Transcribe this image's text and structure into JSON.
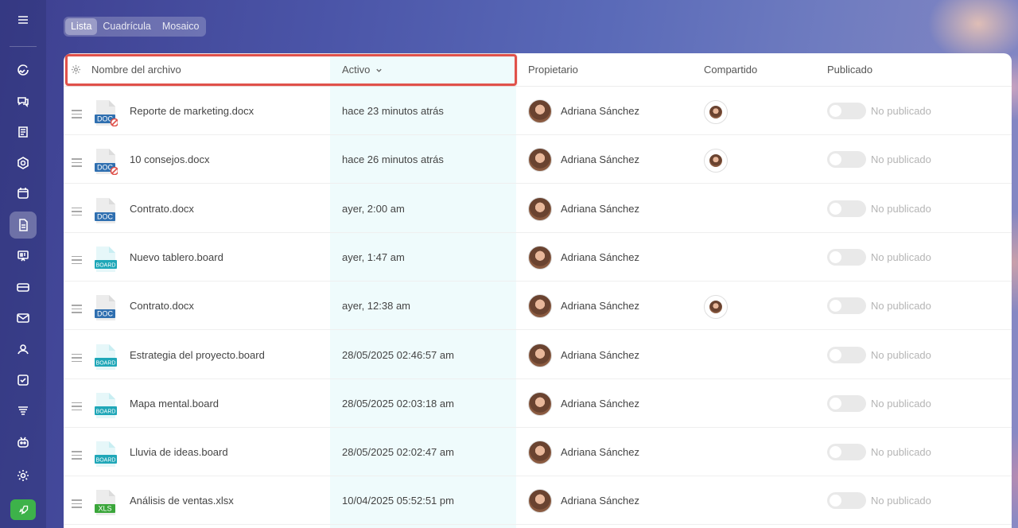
{
  "view_switch": {
    "options": [
      "Lista",
      "Cuadrícula",
      "Mosaico"
    ],
    "active": "Lista"
  },
  "sidebar": {
    "icons": [
      "menu-icon",
      "feed-icon",
      "chat-icon",
      "tasks-doc-icon",
      "disk-icon",
      "calendar-icon",
      "documents-icon",
      "boards-icon",
      "drive-icon",
      "mail-icon",
      "contacts-icon",
      "checklist-icon",
      "filter-icon",
      "robot-icon",
      "settings-icon",
      "rocket-icon"
    ],
    "active": "documents-icon",
    "accent": "#3db24a"
  },
  "table": {
    "headers": {
      "name": "Nombre del archivo",
      "active": "Activo",
      "owner": "Propietario",
      "shared": "Compartido",
      "published": "Publicado"
    },
    "highlight_color": "#e0514a",
    "rows": [
      {
        "type": "DOC",
        "blocked": true,
        "name": "Reporte de marketing.docx",
        "active": "hace 23 minutos atrás",
        "owner": "Adriana Sánchez",
        "shared": true,
        "published": "No publicado"
      },
      {
        "type": "DOC",
        "blocked": true,
        "name": "10 consejos.docx",
        "active": "hace 26 minutos atrás",
        "owner": "Adriana Sánchez",
        "shared": true,
        "published": "No publicado"
      },
      {
        "type": "DOC",
        "blocked": false,
        "name": "Contrato.docx",
        "active": "ayer, 2:00 am",
        "owner": "Adriana Sánchez",
        "shared": false,
        "published": "No publicado"
      },
      {
        "type": "BOARD",
        "blocked": false,
        "name": "Nuevo tablero.board",
        "active": "ayer, 1:47 am",
        "owner": "Adriana Sánchez",
        "shared": false,
        "published": "No publicado"
      },
      {
        "type": "DOC",
        "blocked": false,
        "name": "Contrato.docx",
        "active": "ayer, 12:38 am",
        "owner": "Adriana Sánchez",
        "shared": true,
        "published": "No publicado"
      },
      {
        "type": "BOARD",
        "blocked": false,
        "name": "Estrategia del proyecto.board",
        "active": "28/05/2025 02:46:57 am",
        "owner": "Adriana Sánchez",
        "shared": false,
        "published": "No publicado"
      },
      {
        "type": "BOARD",
        "blocked": false,
        "name": "Mapa mental.board",
        "active": "28/05/2025 02:03:18 am",
        "owner": "Adriana Sánchez",
        "shared": false,
        "published": "No publicado"
      },
      {
        "type": "BOARD",
        "blocked": false,
        "name": "Lluvia de ideas.board",
        "active": "28/05/2025 02:02:47 am",
        "owner": "Adriana Sánchez",
        "shared": false,
        "published": "No publicado"
      },
      {
        "type": "XLS",
        "blocked": false,
        "name": "Análisis de ventas.xlsx",
        "active": "10/04/2025 05:52:51 pm",
        "owner": "Adriana Sánchez",
        "shared": false,
        "published": "No publicado"
      }
    ]
  }
}
